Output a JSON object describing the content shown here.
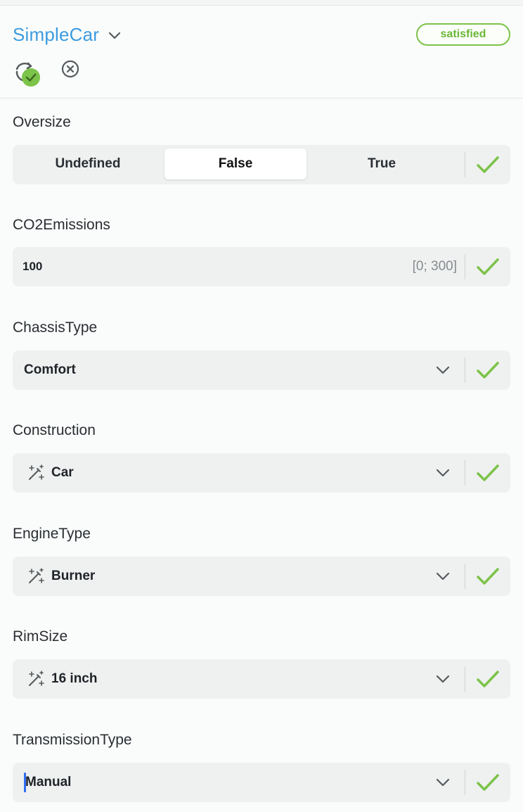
{
  "header": {
    "title": "SimpleCar",
    "status": "satisfied",
    "icons": {
      "title_chevron": "chevron-down-icon",
      "refresh": "refresh-check-icon",
      "close": "close-circle-icon"
    }
  },
  "colors": {
    "accent_blue": "#3d9be0",
    "success_green": "#7cc34a",
    "field_bg": "#eff1f0"
  },
  "fields": {
    "oversize": {
      "label": "Oversize",
      "options": [
        "Undefined",
        "False",
        "True"
      ],
      "selected": "False"
    },
    "co2": {
      "label": "CO2Emissions",
      "value": "100",
      "range": "[0; 300]"
    },
    "chassis": {
      "label": "ChassisType",
      "value": "Comfort"
    },
    "construction": {
      "label": "Construction",
      "value": "Car",
      "icon": "magic-wand-icon"
    },
    "engine": {
      "label": "EngineType",
      "value": "Burner",
      "icon": "magic-wand-icon"
    },
    "rim": {
      "label": "RimSize",
      "value": "16 inch",
      "icon": "magic-wand-icon"
    },
    "transmission": {
      "label": "TransmissionType",
      "value": "Manual"
    }
  }
}
